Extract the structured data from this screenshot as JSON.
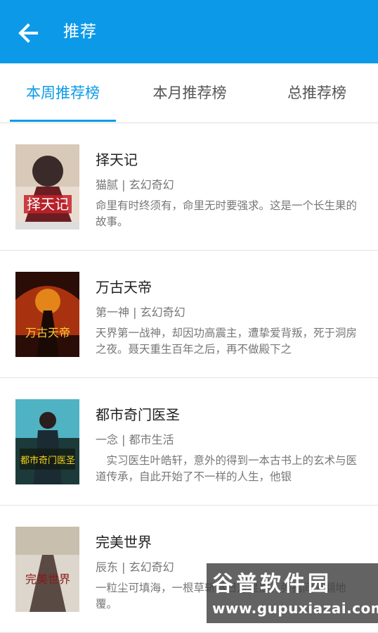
{
  "header": {
    "title": "推荐",
    "back_icon": "arrow-left-icon",
    "color": "#0c9ae8"
  },
  "tabs": [
    {
      "label": "本周推荐榜",
      "active": true
    },
    {
      "label": "本月推荐榜",
      "active": false
    },
    {
      "label": "总推荐榜",
      "active": false
    }
  ],
  "books": [
    {
      "title": "择天记",
      "meta": "猫腻 | 玄幻奇幻",
      "desc": "命里有时终须有，命里无时要强求。这是一个长生果的故事。",
      "cover_text": "择天记"
    },
    {
      "title": "万古天帝",
      "meta": "第一神 | 玄幻奇幻",
      "desc": "天界第一战神，却因功高震主，遭挚爱背叛，死于洞房之夜。聂天重生百年之后，再不做殿下之",
      "cover_text": "万古天帝"
    },
    {
      "title": "都市奇门医圣",
      "meta": "一念 | 都市生活",
      "desc": "　实习医生叶皓轩，意外的得到一本古书上的玄术与医道传承，自此开始了不一样的人生，他银",
      "cover_text": "都市奇门医圣"
    },
    {
      "title": "完美世界",
      "meta": "辰东 | 玄幻奇幻",
      "desc": "一粒尘可填海，一根草斩尽日月星辰，弹指间天翻地覆。",
      "cover_text": "完美世界"
    }
  ],
  "watermark": {
    "brand": "谷普软件园",
    "url": "www.gupuxiazai.com"
  }
}
